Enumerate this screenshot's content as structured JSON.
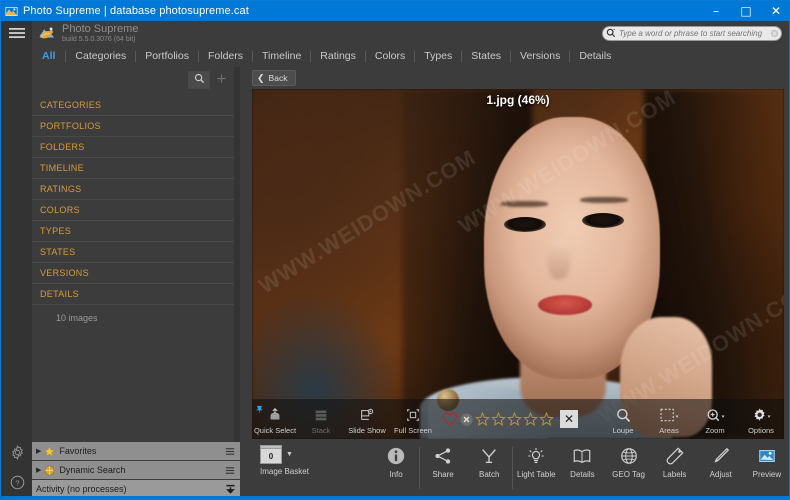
{
  "window": {
    "title": "Photo Supreme | database photosupreme.cat",
    "app_icon": "photo-supreme-icon",
    "minimize_label": "–",
    "maximize_label": "□",
    "close_label": "✕",
    "accent_color": "#0078d7"
  },
  "header": {
    "brand_name": "Photo Supreme",
    "brand_build": "build 5.5.0.3076 (64 bit)",
    "menu_icon": "hamburger-menu-icon",
    "logo_icon": "photo-supreme-logo-icon"
  },
  "search": {
    "value": "",
    "placeholder": "Type a word or phrase to start searching",
    "search_icon": "magnifier-icon",
    "clear_icon": "clear-circle-icon"
  },
  "tabs": [
    {
      "label": "All",
      "active": true
    },
    {
      "label": "Categories",
      "active": false
    },
    {
      "label": "Portfolios",
      "active": false
    },
    {
      "label": "Folders",
      "active": false
    },
    {
      "label": "Timeline",
      "active": false
    },
    {
      "label": "Ratings",
      "active": false
    },
    {
      "label": "Colors",
      "active": false
    },
    {
      "label": "Types",
      "active": false
    },
    {
      "label": "States",
      "active": false
    },
    {
      "label": "Versions",
      "active": false
    },
    {
      "label": "Details",
      "active": false
    }
  ],
  "sidebar": {
    "search_icon": "magnifier-icon",
    "add_icon": "plus-icon",
    "section_color": "#d79b3a",
    "sections": [
      {
        "label": "CATEGORIES"
      },
      {
        "label": "PORTFOLIOS"
      },
      {
        "label": "FOLDERS"
      },
      {
        "label": "TIMELINE"
      },
      {
        "label": "RATINGS"
      },
      {
        "label": "COLORS"
      },
      {
        "label": "TYPES"
      },
      {
        "label": "STATES"
      },
      {
        "label": "VERSIONS"
      },
      {
        "label": "DETAILS"
      }
    ],
    "image_count": "10 images"
  },
  "rail": {
    "menu_icon": "hamburger-menu-icon",
    "settings_icon": "gear-icon",
    "help_icon": "help-circle-icon"
  },
  "panels": [
    {
      "label": "Favorites",
      "icon": "star-icon",
      "expander": "▶",
      "menu_icon": "list-menu-icon"
    },
    {
      "label": "Dynamic Search",
      "icon": "dynamic-search-icon",
      "expander": "▶",
      "menu_icon": "list-menu-icon"
    }
  ],
  "activity": {
    "label": "Activity (no processes)",
    "icon": "collapse-down-icon"
  },
  "viewer": {
    "back_label": "Back",
    "back_icon": "chevron-left-icon",
    "file_label": "1.jpg (46%)",
    "file_name": "1.jpg",
    "zoom_percent": "46%",
    "watermark": "WWW.WEIDOWN.COM"
  },
  "overlay_toolbar": {
    "pin_icon": "pin-icon",
    "items": [
      {
        "label": "Quick Select",
        "icon": "quick-select-icon",
        "dimmed": false
      },
      {
        "label": "Stack",
        "icon": "stack-icon",
        "dimmed": true
      },
      {
        "label": "Slide Show",
        "icon": "slide-show-icon",
        "dimmed": false
      },
      {
        "label": "Full Screen",
        "icon": "full-screen-icon",
        "dimmed": false
      }
    ],
    "flag_icon": "heart-icon",
    "reject_icon": "reject-circle-icon",
    "rating_stars": 5,
    "rating_value": 0,
    "star_icon": "star-outline-icon",
    "close_icon": "close-box-icon",
    "right_items": [
      {
        "label": "Loupe",
        "icon": "loupe-icon",
        "caret": false
      },
      {
        "label": "Areas",
        "icon": "areas-icon",
        "caret": true
      },
      {
        "label": "Zoom",
        "icon": "zoom-icon",
        "caret": true
      },
      {
        "label": "Options",
        "icon": "gear-icon",
        "caret": true
      }
    ]
  },
  "bottom_toolbar": {
    "basket": {
      "label": "Image Basket",
      "count": "0",
      "caret": "▼",
      "icon": "basket-icon"
    },
    "items": [
      {
        "label": "Info",
        "icon": "info-icon"
      },
      {
        "label": "Share",
        "icon": "share-icon"
      },
      {
        "label": "Batch",
        "icon": "batch-icon"
      },
      {
        "label": "Light Table",
        "icon": "light-table-icon"
      },
      {
        "label": "Details",
        "icon": "details-book-icon"
      },
      {
        "label": "GEO Tag",
        "icon": "globe-icon"
      },
      {
        "label": "Labels",
        "icon": "tag-icon"
      },
      {
        "label": "Adjust",
        "icon": "brush-icon"
      },
      {
        "label": "Preview",
        "icon": "preview-icon"
      }
    ]
  }
}
